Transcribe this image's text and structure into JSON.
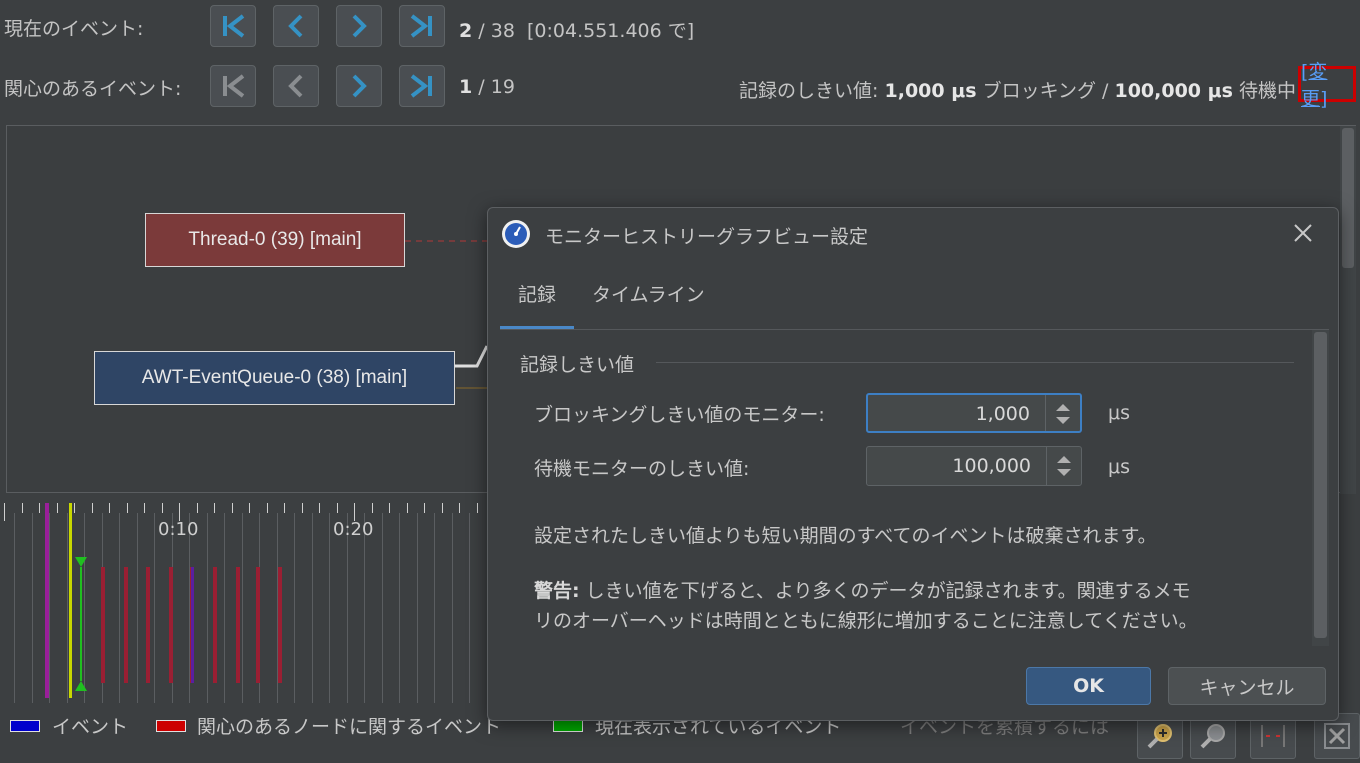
{
  "nav": {
    "current_label": "現在のイベント:",
    "current_index": "2",
    "current_sep": "/",
    "current_total": "38",
    "current_time": "[0:04.551.406 で]",
    "interest_label": "関心のあるイベント:",
    "interest_index": "1",
    "interest_sep": "/",
    "interest_total": "19"
  },
  "threshold": {
    "label": "記録のしきい値:",
    "blocking_value": "1,000 μs",
    "blocking_text": "ブロッキング /",
    "waiting_value": "100,000 μs",
    "waiting_text": "待機中",
    "change_link": "[変更]"
  },
  "graph": {
    "nodes": [
      {
        "label": "Thread-0 (39) [main]",
        "color": "#7b3a3a"
      },
      {
        "label": "AWT-EventQueue-0 (38) [main]",
        "color": "#2f4565"
      }
    ]
  },
  "timeline": {
    "ticks": [
      "0:10",
      "0:20"
    ]
  },
  "legend": [
    {
      "label": "イベント",
      "color": "#0000cc"
    },
    {
      "label": "関心のあるノードに関するイベント",
      "color": "#cc0000"
    },
    {
      "label": "現在表示されているイベント",
      "color": "#00aa00"
    },
    {
      "label": "イベントを累積するには",
      "color": ""
    }
  ],
  "dialog": {
    "title": "モニターヒストリーグラフビュー設定",
    "tabs": [
      {
        "label": "記録",
        "active": true
      },
      {
        "label": "タイムライン",
        "active": false
      }
    ],
    "section_title": "記録しきい値",
    "blocking_label": "ブロッキングしきい値のモニター:",
    "blocking_value": "1,000",
    "blocking_unit": "μs",
    "waiting_label": "待機モニターのしきい値:",
    "waiting_value": "100,000",
    "waiting_unit": "μs",
    "info_text": "設定されたしきい値よりも短い期間のすべてのイベントは破棄されます。",
    "warning_bold": "警告:",
    "warning_line1": " しきい値を下げると、より多くのデータが記録されます。関連するメモ",
    "warning_line2": "リのオーバーヘッドは時間とともに線形に増加することに注意してください。",
    "ok_label": "OK",
    "cancel_label": "キャンセル"
  },
  "colors": {
    "accent": "#3592c4",
    "highlight_border": "#cc0000",
    "link": "#589df6"
  }
}
